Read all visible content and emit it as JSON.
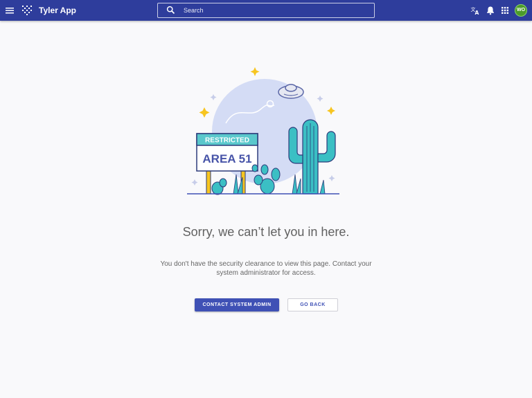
{
  "header": {
    "app_title": "Tyler App",
    "search_placeholder": "Search",
    "avatar_initials": "WO"
  },
  "illustration": {
    "sign_top": "RESTRICTED",
    "sign_main": "AREA 51"
  },
  "main": {
    "heading": "Sorry, we can’t let you in here.",
    "message": "You don't have the security clearance to view this page. Contact your system administrator for access.",
    "primary_button": "CONTACT SYSTEM ADMIN",
    "secondary_button": "GO BACK"
  },
  "colors": {
    "header_bg": "#2e3d9c",
    "accent": "#3f51b5",
    "avatar_bg": "#4c9a2a",
    "cactus": "#3bbfc4",
    "sign_header": "#5ac8cc",
    "star": "#f7c520",
    "moon": "#d4dcf5"
  }
}
